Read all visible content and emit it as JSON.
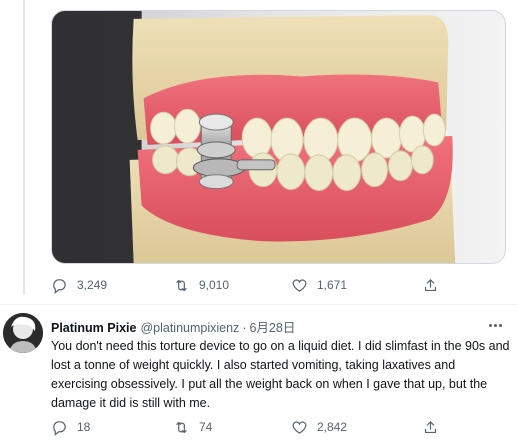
{
  "first_tweet": {
    "actions": {
      "replies": "3,249",
      "retweets": "9,010",
      "likes": "1,671"
    }
  },
  "reply_tweet": {
    "display_name": "Platinum Pixie",
    "handle": "@platinumpixienz",
    "separator": "·",
    "date": "6月28日",
    "text": "You don't need this torture device to go on a liquid diet. I did slimfast in the 90s and lost a tonne of weight quickly. I also started vomiting, taking laxatives and exercising obsessively. I put all the weight back on when I gave that up, but the damage it did is still with me.",
    "actions": {
      "replies": "18",
      "retweets": "74",
      "likes": "2,842"
    }
  },
  "icons": {
    "reply": "reply-icon",
    "retweet": "retweet-icon",
    "like": "heart-icon",
    "share": "share-icon",
    "more": "more-icon"
  },
  "colors": {
    "secondary_text": "#536471",
    "border": "#cfd9de",
    "primary_text": "#0f1419"
  }
}
